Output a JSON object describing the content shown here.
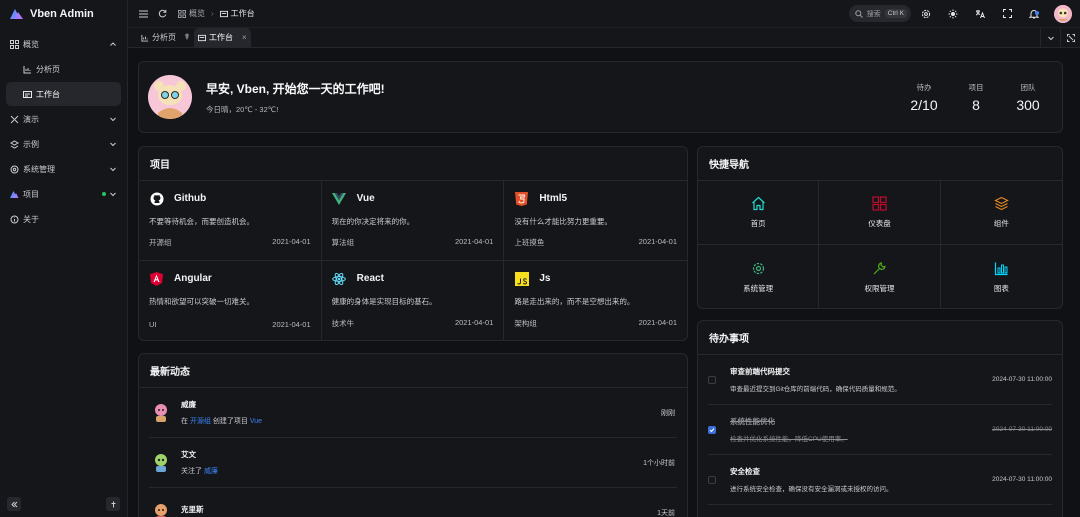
{
  "app": {
    "title": "Vben Admin"
  },
  "sidebar": {
    "items": [
      {
        "label": "概览",
        "icon": "grid-icon"
      },
      {
        "label": "分析页",
        "icon": "chart-icon"
      },
      {
        "label": "工作台",
        "icon": "workspace-icon"
      },
      {
        "label": "演示",
        "icon": "demo-icon"
      },
      {
        "label": "示例",
        "icon": "examples-icon"
      },
      {
        "label": "系统管理",
        "icon": "settings-icon"
      },
      {
        "label": "项目",
        "icon": "project-icon"
      },
      {
        "label": "关于",
        "icon": "info-icon"
      }
    ]
  },
  "header": {
    "breadcrumb": [
      "概览",
      "工作台"
    ],
    "search_placeholder": "搜索",
    "search_shortcut": "Ctrl K"
  },
  "tabs": [
    {
      "label": "分析页"
    },
    {
      "label": "工作台"
    }
  ],
  "welcome": {
    "greeting": "早安, Vben, 开始您一天的工作吧!",
    "weather": "今日晴，20℃ - 32℃!",
    "stats": [
      {
        "label": "待办",
        "value": "2/10"
      },
      {
        "label": "项目",
        "value": "8"
      },
      {
        "label": "团队",
        "value": "300"
      }
    ]
  },
  "projects": {
    "title": "项目",
    "items": [
      {
        "name": "Github",
        "desc": "不要等待机会，而要创造机会。",
        "group": "开源组",
        "date": "2021-04-01",
        "color": "#ffffff"
      },
      {
        "name": "Vue",
        "desc": "现在的你决定将来的你。",
        "group": "算法组",
        "date": "2021-04-01",
        "color": "#3fb27f"
      },
      {
        "name": "Html5",
        "desc": "没有什么才能比努力更重要。",
        "group": "上班摸鱼",
        "date": "2021-04-01",
        "color": "#e34f26"
      },
      {
        "name": "Angular",
        "desc": "热情和欲望可以突破一切难关。",
        "group": "UI",
        "date": "2021-04-01",
        "color": "#dd0031"
      },
      {
        "name": "React",
        "desc": "健康的身体是实现目标的基石。",
        "group": "技术牛",
        "date": "2021-04-01",
        "color": "#61dafb"
      },
      {
        "name": "Js",
        "desc": "路是走出来的，而不是空想出来的。",
        "group": "架构组",
        "date": "2021-04-01",
        "color": "#f7df1e"
      }
    ]
  },
  "quick_nav": {
    "title": "快捷导航",
    "items": [
      {
        "label": "首页",
        "icon": "home-icon",
        "color": "#1fdaca"
      },
      {
        "label": "仪表盘",
        "icon": "dashboard-icon",
        "color": "#bf0c2c"
      },
      {
        "label": "组件",
        "icon": "layers-icon",
        "color": "#e18525"
      },
      {
        "label": "系统管理",
        "icon": "gear-icon",
        "color": "#3fb27f"
      },
      {
        "label": "权限管理",
        "icon": "wrench-icon",
        "color": "#4daf1bc9"
      },
      {
        "label": "图表",
        "icon": "bar-chart-icon",
        "color": "#00d8ff"
      }
    ]
  },
  "activity": {
    "title": "最新动态",
    "items": [
      {
        "name": "威廉",
        "prefix": "在",
        "link": "开源组",
        "middle": "创建了项目",
        "target": "Vue",
        "time": "刚刚"
      },
      {
        "name": "艾文",
        "prefix": "关注了",
        "link": "威廉",
        "middle": "",
        "target": "",
        "time": "1个小时前"
      },
      {
        "name": "克里斯",
        "prefix": "",
        "link": "",
        "middle": "",
        "target": "",
        "time": "1天前"
      }
    ]
  },
  "todo": {
    "title": "待办事项",
    "items": [
      {
        "title": "审查前端代码提交",
        "desc": "审查最近提交到Git仓库的前端代码，确保代码质量和规范。",
        "time": "2024-07-30 11:00:00",
        "done": false
      },
      {
        "title": "系统性能优化",
        "desc": "检查并优化系统性能，降低CPU使用率。",
        "time": "2024-07-30 11:00:00",
        "done": true
      },
      {
        "title": "安全检查",
        "desc": "进行系统安全检查，确保没有安全漏洞或未授权的访问。",
        "time": "2024-07-30 11:00:00",
        "done": false
      }
    ]
  }
}
